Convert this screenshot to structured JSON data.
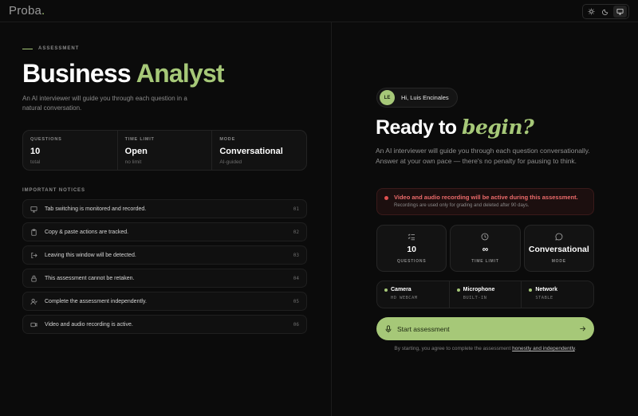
{
  "header": {
    "logo_text": "Proba",
    "logo_dot": ".",
    "theme_buttons": [
      {
        "icon": "sun-icon"
      },
      {
        "icon": "moon-icon"
      },
      {
        "icon": "monitor-icon",
        "active": true
      }
    ]
  },
  "left": {
    "eyebrow": "ASSESSMENT",
    "title_main": "Business ",
    "title_accent": "Analyst",
    "subtitle": "An AI interviewer will guide you through each question in a natural conversation.",
    "stats": [
      {
        "label": "QUESTIONS",
        "value": "10",
        "sub": "total"
      },
      {
        "label": "TIME LIMIT",
        "value": "Open",
        "sub": "no limit"
      },
      {
        "label": "MODE",
        "value": "Conversational",
        "sub": "AI-guided"
      }
    ],
    "notices_title": "IMPORTANT NOTICES",
    "notices": [
      {
        "icon": "monitor-icon",
        "text": "Tab switching is monitored and recorded.",
        "num": "01"
      },
      {
        "icon": "clipboard-icon",
        "text": "Copy & paste actions are tracked.",
        "num": "02"
      },
      {
        "icon": "exit-icon",
        "text": "Leaving this window will be detected.",
        "num": "03"
      },
      {
        "icon": "lock-icon",
        "text": "This assessment cannot be retaken.",
        "num": "04"
      },
      {
        "icon": "user-check-icon",
        "text": "Complete the assessment independently.",
        "num": "05"
      },
      {
        "icon": "video-icon",
        "text": "Video and audio recording is active.",
        "num": "06"
      }
    ]
  },
  "right": {
    "avatar_initials": "LE",
    "greeting": "Hi, Luis Encinales",
    "ready_main": "Ready to ",
    "ready_accent": "begin?",
    "description": "An AI interviewer will guide you through each question conversationally. Answer at your own pace — there's no penalty for pausing to think.",
    "alert": {
      "title": "Video and audio recording will be active during this assessment.",
      "sub": "Recordings are used only for grading and deleted after 90 days."
    },
    "cards": [
      {
        "icon": "list-check-icon",
        "value": "10",
        "label": "QUESTIONS"
      },
      {
        "icon": "clock-icon",
        "value": "∞",
        "label": "TIME LIMIT"
      },
      {
        "icon": "chat-icon",
        "value": "Conversational",
        "label": "MODE"
      }
    ],
    "devices": [
      {
        "name": "Camera",
        "status": "HD WEBCAM"
      },
      {
        "name": "Microphone",
        "status": "BUILT-IN"
      },
      {
        "name": "Network",
        "status": "STABLE"
      }
    ],
    "start_label": "Start assessment",
    "consent_prefix": "By starting, you agree to complete the assessment ",
    "consent_link": "honestly and independently",
    "consent_suffix": "."
  },
  "colors": {
    "accent": "#a6c878",
    "background": "#0b0b0b",
    "alert_red": "#ec6b6b"
  }
}
